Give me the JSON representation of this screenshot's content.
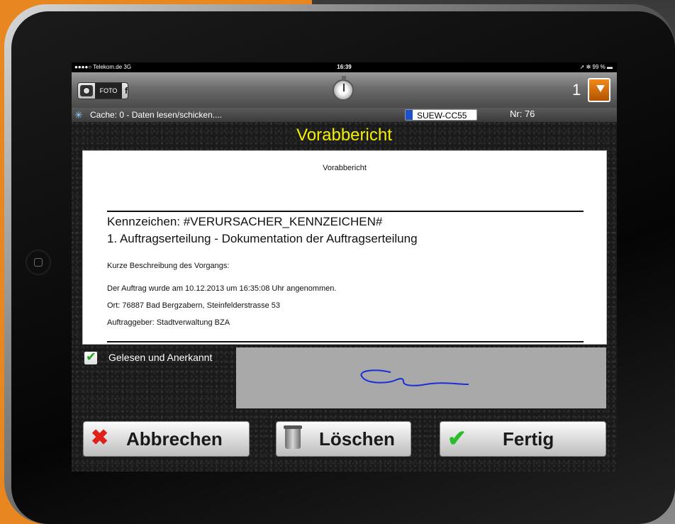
{
  "status_bar": {
    "carrier": "●●●●○ Telekom.de  3G",
    "time": "16:39",
    "battery": "➚ ✻ 99 % ▬"
  },
  "toolbar": {
    "foto_label": "FOTO",
    "foto_extra": "f",
    "count": "1"
  },
  "info_bar": {
    "cache_text": "Cache: 0  -  Daten lesen/schicken....",
    "plate": "SUEW-CC55",
    "nr": "Nr: 76"
  },
  "page_title": "Vorabbericht",
  "document": {
    "heading": "Vorabbericht",
    "line1": "Kennzeichen: #VERURSACHER_KENNZEICHEN#",
    "line2": "1. Auftragserteilung - Dokumentation der Auftragserteilung",
    "desc": "Kurze Beschreibung des Vorgangs:",
    "accepted": "Der Auftrag wurde am 10.12.2013 um 16:35:08 Uhr angenommen.",
    "location": "Ort: 76887 Bad Bergzabern, Steinfelderstrasse 53",
    "client": "Auftraggeber: Stadtverwaltung BZA"
  },
  "confirm_checkbox": {
    "label": "Gelesen und Anerkannt",
    "checked": true
  },
  "buttons": {
    "cancel": "Abbrechen",
    "delete": "Löschen",
    "done": "Fertig"
  },
  "colors": {
    "title": "#f5ef00",
    "signature_area": "#a9a9a9",
    "signature_stroke": "#1a2fd6",
    "page_background": "#e8871f"
  },
  "icons": {
    "camera": "camera-icon",
    "timer": "stopwatch-icon",
    "box": "package-icon",
    "sync": "sync-icon",
    "cancel": "x-icon",
    "delete": "trash-icon",
    "done": "checkmark-icon"
  }
}
